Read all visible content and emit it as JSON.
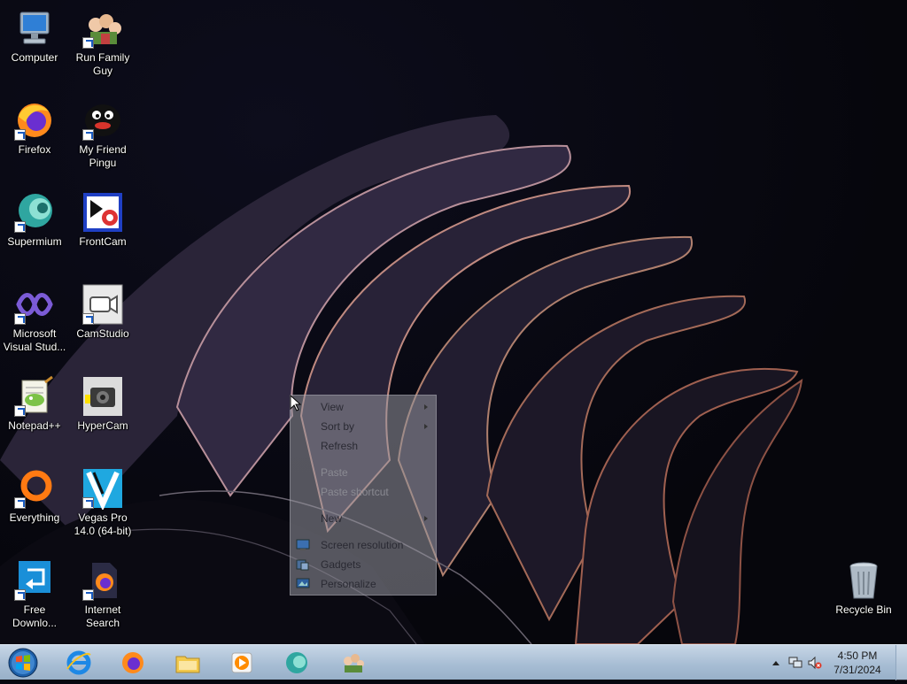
{
  "desktop": {
    "icons": [
      {
        "label": "Computer"
      },
      {
        "label": "Run Family Guy"
      },
      {
        "label": "Firefox"
      },
      {
        "label": "My Friend Pingu"
      },
      {
        "label": "Supermium"
      },
      {
        "label": "FrontCam"
      },
      {
        "label": "Microsoft Visual Stud..."
      },
      {
        "label": "CamStudio"
      },
      {
        "label": "Notepad++"
      },
      {
        "label": "HyperCam"
      },
      {
        "label": "Everything"
      },
      {
        "label": "Vegas Pro 14.0 (64-bit)"
      },
      {
        "label": "Free Downlo..."
      },
      {
        "label": "Internet Search"
      },
      {
        "label": "Recycle Bin"
      }
    ]
  },
  "context_menu": {
    "items": [
      {
        "label": "View",
        "has_submenu": true,
        "enabled": true
      },
      {
        "label": "Sort by",
        "has_submenu": true,
        "enabled": true
      },
      {
        "label": "Refresh",
        "enabled": true
      },
      {
        "label": "Paste",
        "enabled": false
      },
      {
        "label": "Paste shortcut",
        "enabled": false
      },
      {
        "label": "New",
        "has_submenu": true,
        "enabled": true
      },
      {
        "label": "Screen resolution",
        "icon": "display-icon",
        "enabled": true
      },
      {
        "label": "Gadgets",
        "icon": "gadgets-icon",
        "enabled": true
      },
      {
        "label": "Personalize",
        "icon": "personalize-icon",
        "enabled": true
      }
    ]
  },
  "taskbar": {
    "pinned": [
      "internet-explorer-icon",
      "firefox-icon",
      "file-explorer-icon",
      "media-player-icon",
      "supermium-icon",
      "family-guy-icon"
    ],
    "clock": {
      "time": "4:50 PM",
      "date": "7/31/2024"
    },
    "tray_icons": [
      "show-hidden-icons-chevron",
      "network-icon",
      "volume-muted-icon"
    ]
  },
  "colors": {
    "taskbar": "#a6bcd3",
    "desktop_bg": "#07070f"
  }
}
